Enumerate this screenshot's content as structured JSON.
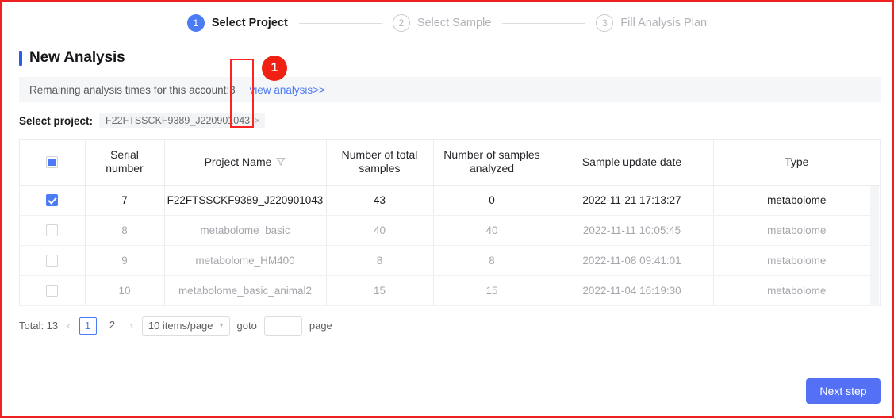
{
  "stepper": {
    "steps": [
      {
        "num": "1",
        "label": "Select Project",
        "state": "active"
      },
      {
        "num": "2",
        "label": "Select Sample",
        "state": "idle"
      },
      {
        "num": "3",
        "label": "Fill Analysis Plan",
        "state": "idle"
      }
    ]
  },
  "page": {
    "title": "New Analysis"
  },
  "banner": {
    "text": "Remaining analysis times for this account:3",
    "link": "view analysis>>"
  },
  "select_project": {
    "label": "Select project:",
    "tag_value": "F22FTSSCKF9389_J220901043",
    "close_icon": "×"
  },
  "table": {
    "columns": [
      "Serial number",
      "Project Name",
      "Number of total samples",
      "Number of samples analyzed",
      "Sample update date",
      "Type"
    ],
    "header_checkbox_state": "indeterminate",
    "filter_column": "Project Name",
    "rows": [
      {
        "checked": true,
        "serial": "7",
        "name": "F22FTSSCKF9389_J220901043",
        "total": "43",
        "analyzed": "0",
        "updated": "2022-11-21 17:13:27",
        "type": "metabolome"
      },
      {
        "checked": false,
        "serial": "8",
        "name": "metabolome_basic",
        "total": "40",
        "analyzed": "40",
        "updated": "2022-11-11 10:05:45",
        "type": "metabolome"
      },
      {
        "checked": false,
        "serial": "9",
        "name": "metabolome_HM400",
        "total": "8",
        "analyzed": "8",
        "updated": "2022-11-08 09:41:01",
        "type": "metabolome"
      },
      {
        "checked": false,
        "serial": "10",
        "name": "metabolome_basic_animal2",
        "total": "15",
        "analyzed": "15",
        "updated": "2022-11-04 16:19:30",
        "type": "metabolome"
      }
    ]
  },
  "pagination": {
    "total": "Total: 13",
    "prev": "‹",
    "next": "›",
    "pages": [
      "1",
      "2"
    ],
    "current_page": "1",
    "page_size": "10 items/page",
    "goto_label": "goto",
    "goto_value": "",
    "page_label": "page"
  },
  "footer": {
    "next_step": "Next step"
  },
  "annotations": {
    "marker_1": "1"
  },
  "colors": {
    "accent_blue": "#4b7bf5",
    "button_blue": "#5470f5",
    "annotation_red": "#f02112",
    "banner_bg": "#f5f6f8"
  }
}
